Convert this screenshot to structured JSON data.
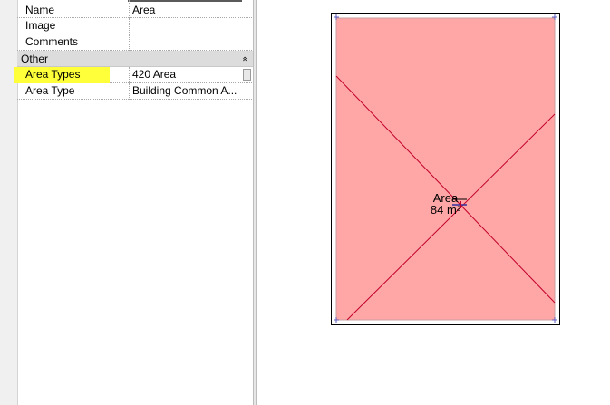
{
  "properties": {
    "rows_top": [
      {
        "name": "Name",
        "value": "Area"
      },
      {
        "name": "Image",
        "value": ""
      },
      {
        "name": "Comments",
        "value": ""
      }
    ],
    "group": {
      "title": "Other",
      "collapse_icon": "chevron-double-up-icon",
      "collapse_glyph": "»"
    },
    "rows_other": [
      {
        "name": "Area Types",
        "value": "420 Area"
      },
      {
        "name": "Area Type",
        "value": "Building Common A..."
      }
    ],
    "highlight_color": "#ffff3a"
  },
  "drawing": {
    "area_name": "Area",
    "area_value": "84 m²",
    "fill_color": "#ffa6a6",
    "line_color": "#c0002a"
  }
}
